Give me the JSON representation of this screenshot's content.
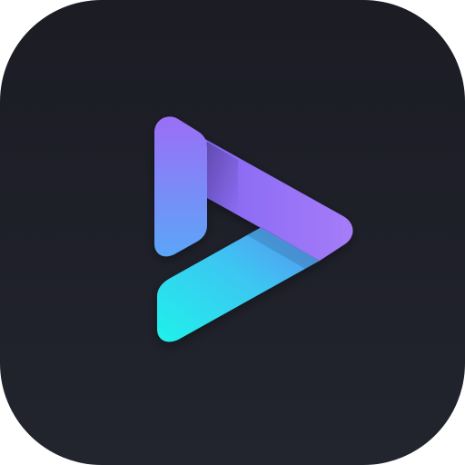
{
  "icon": {
    "semantic_name": "play-logo-icon",
    "colors": {
      "background_top": "#1b1c24",
      "background_bottom": "#22242e",
      "accent_violet": "#a273f7",
      "accent_blue": "#6f8ff9",
      "accent_cyan": "#1ff2ea"
    }
  }
}
